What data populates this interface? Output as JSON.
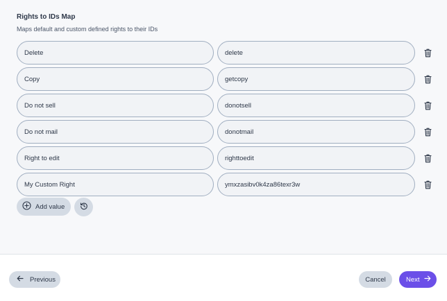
{
  "section": {
    "title": "Rights to IDs Map",
    "description": "Maps default and custom defined rights to their IDs"
  },
  "mappings": [
    {
      "right": "Delete",
      "id": "delete"
    },
    {
      "right": "Copy",
      "id": "getcopy"
    },
    {
      "right": "Do not sell",
      "id": "donotsell"
    },
    {
      "right": "Do not mail",
      "id": "donotmail"
    },
    {
      "right": "Right to edit",
      "id": "righttoedit"
    },
    {
      "right": "My Custom Right",
      "id": "ymxzasibv0k4za86texr3w"
    }
  ],
  "actions": {
    "add_label": "Add value",
    "add_icon": "plus-circle-icon",
    "reset_icon": "history-icon",
    "delete_icon": "trash-icon"
  },
  "footer": {
    "previous_label": "Previous",
    "cancel_label": "Cancel",
    "next_label": "Next"
  },
  "colors": {
    "accent": "#6b4fe8",
    "button_neutral": "#d4dbe4",
    "field_border": "#a0aec0"
  }
}
